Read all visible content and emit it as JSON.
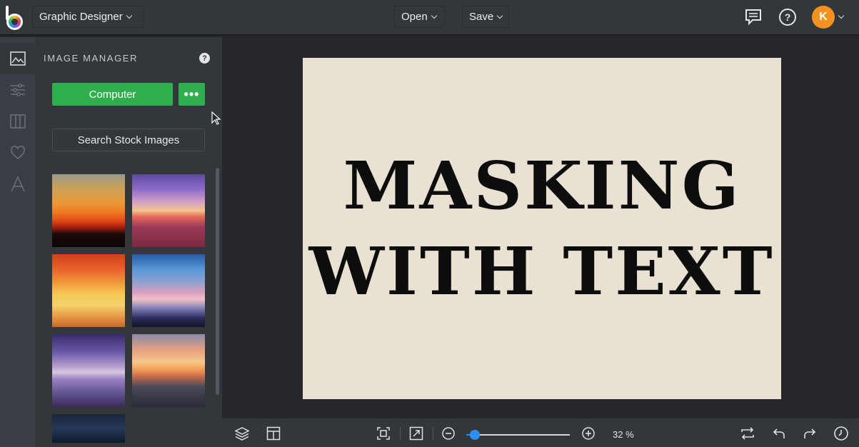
{
  "topbar": {
    "mode_label": "Graphic Designer",
    "open_label": "Open",
    "save_label": "Save",
    "avatar_letter": "K"
  },
  "rail": {
    "items": [
      "image-manager",
      "adjustments",
      "frames",
      "favorites",
      "text"
    ]
  },
  "image_manager": {
    "title": "IMAGE MANAGER",
    "help": "?",
    "computer_button": "Computer",
    "more_button": "•••",
    "stock_button": "Search Stock Images",
    "thumbnails": [
      "sunset-birds",
      "purple-sea-sunset",
      "tree-in-water-sunset",
      "blue-pink-sky",
      "purple-horizon-tree",
      "ocean-sunrise",
      "dark-blue-texture"
    ]
  },
  "artboard": {
    "line1": "MASKING",
    "line2": "WITH TEXT",
    "background": "#e9e1d2"
  },
  "zoom": {
    "label": "32 %",
    "value_percent": 32,
    "slider_fraction": 0.08
  },
  "colors": {
    "accent_green": "#2fae4e",
    "accent_blue": "#2d8ef5",
    "avatar_orange": "#f5911e"
  }
}
